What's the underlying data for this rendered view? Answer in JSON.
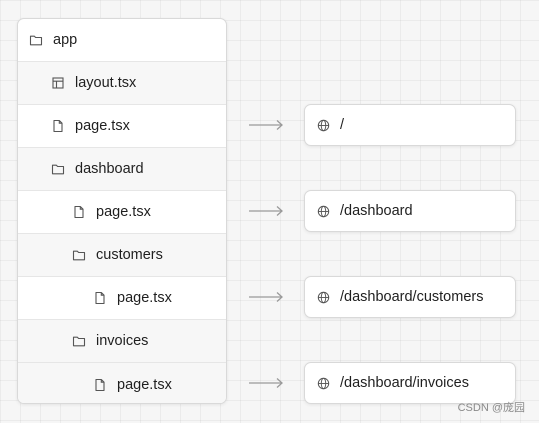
{
  "tree": {
    "items": [
      {
        "label": "app",
        "icon": "folder-icon"
      },
      {
        "label": "layout.tsx",
        "icon": "layout-file-icon"
      },
      {
        "label": "page.tsx",
        "icon": "file-icon"
      },
      {
        "label": "dashboard",
        "icon": "folder-icon"
      },
      {
        "label": "page.tsx",
        "icon": "file-icon"
      },
      {
        "label": "customers",
        "icon": "folder-icon"
      },
      {
        "label": "page.tsx",
        "icon": "file-icon"
      },
      {
        "label": "invoices",
        "icon": "folder-icon"
      },
      {
        "label": "page.tsx",
        "icon": "file-icon"
      }
    ]
  },
  "routes": [
    {
      "path": "/",
      "icon": "globe-icon"
    },
    {
      "path": "/dashboard",
      "icon": "globe-icon"
    },
    {
      "path": "/dashboard/customers",
      "icon": "globe-icon"
    },
    {
      "path": "/dashboard/invoices",
      "icon": "globe-icon"
    }
  ],
  "watermark": "CSDN @庞园",
  "colors": {
    "panel": "#ffffff",
    "border": "#d9d9d9",
    "arrow": "#9a9a9a",
    "text": "#1f1f1f"
  }
}
